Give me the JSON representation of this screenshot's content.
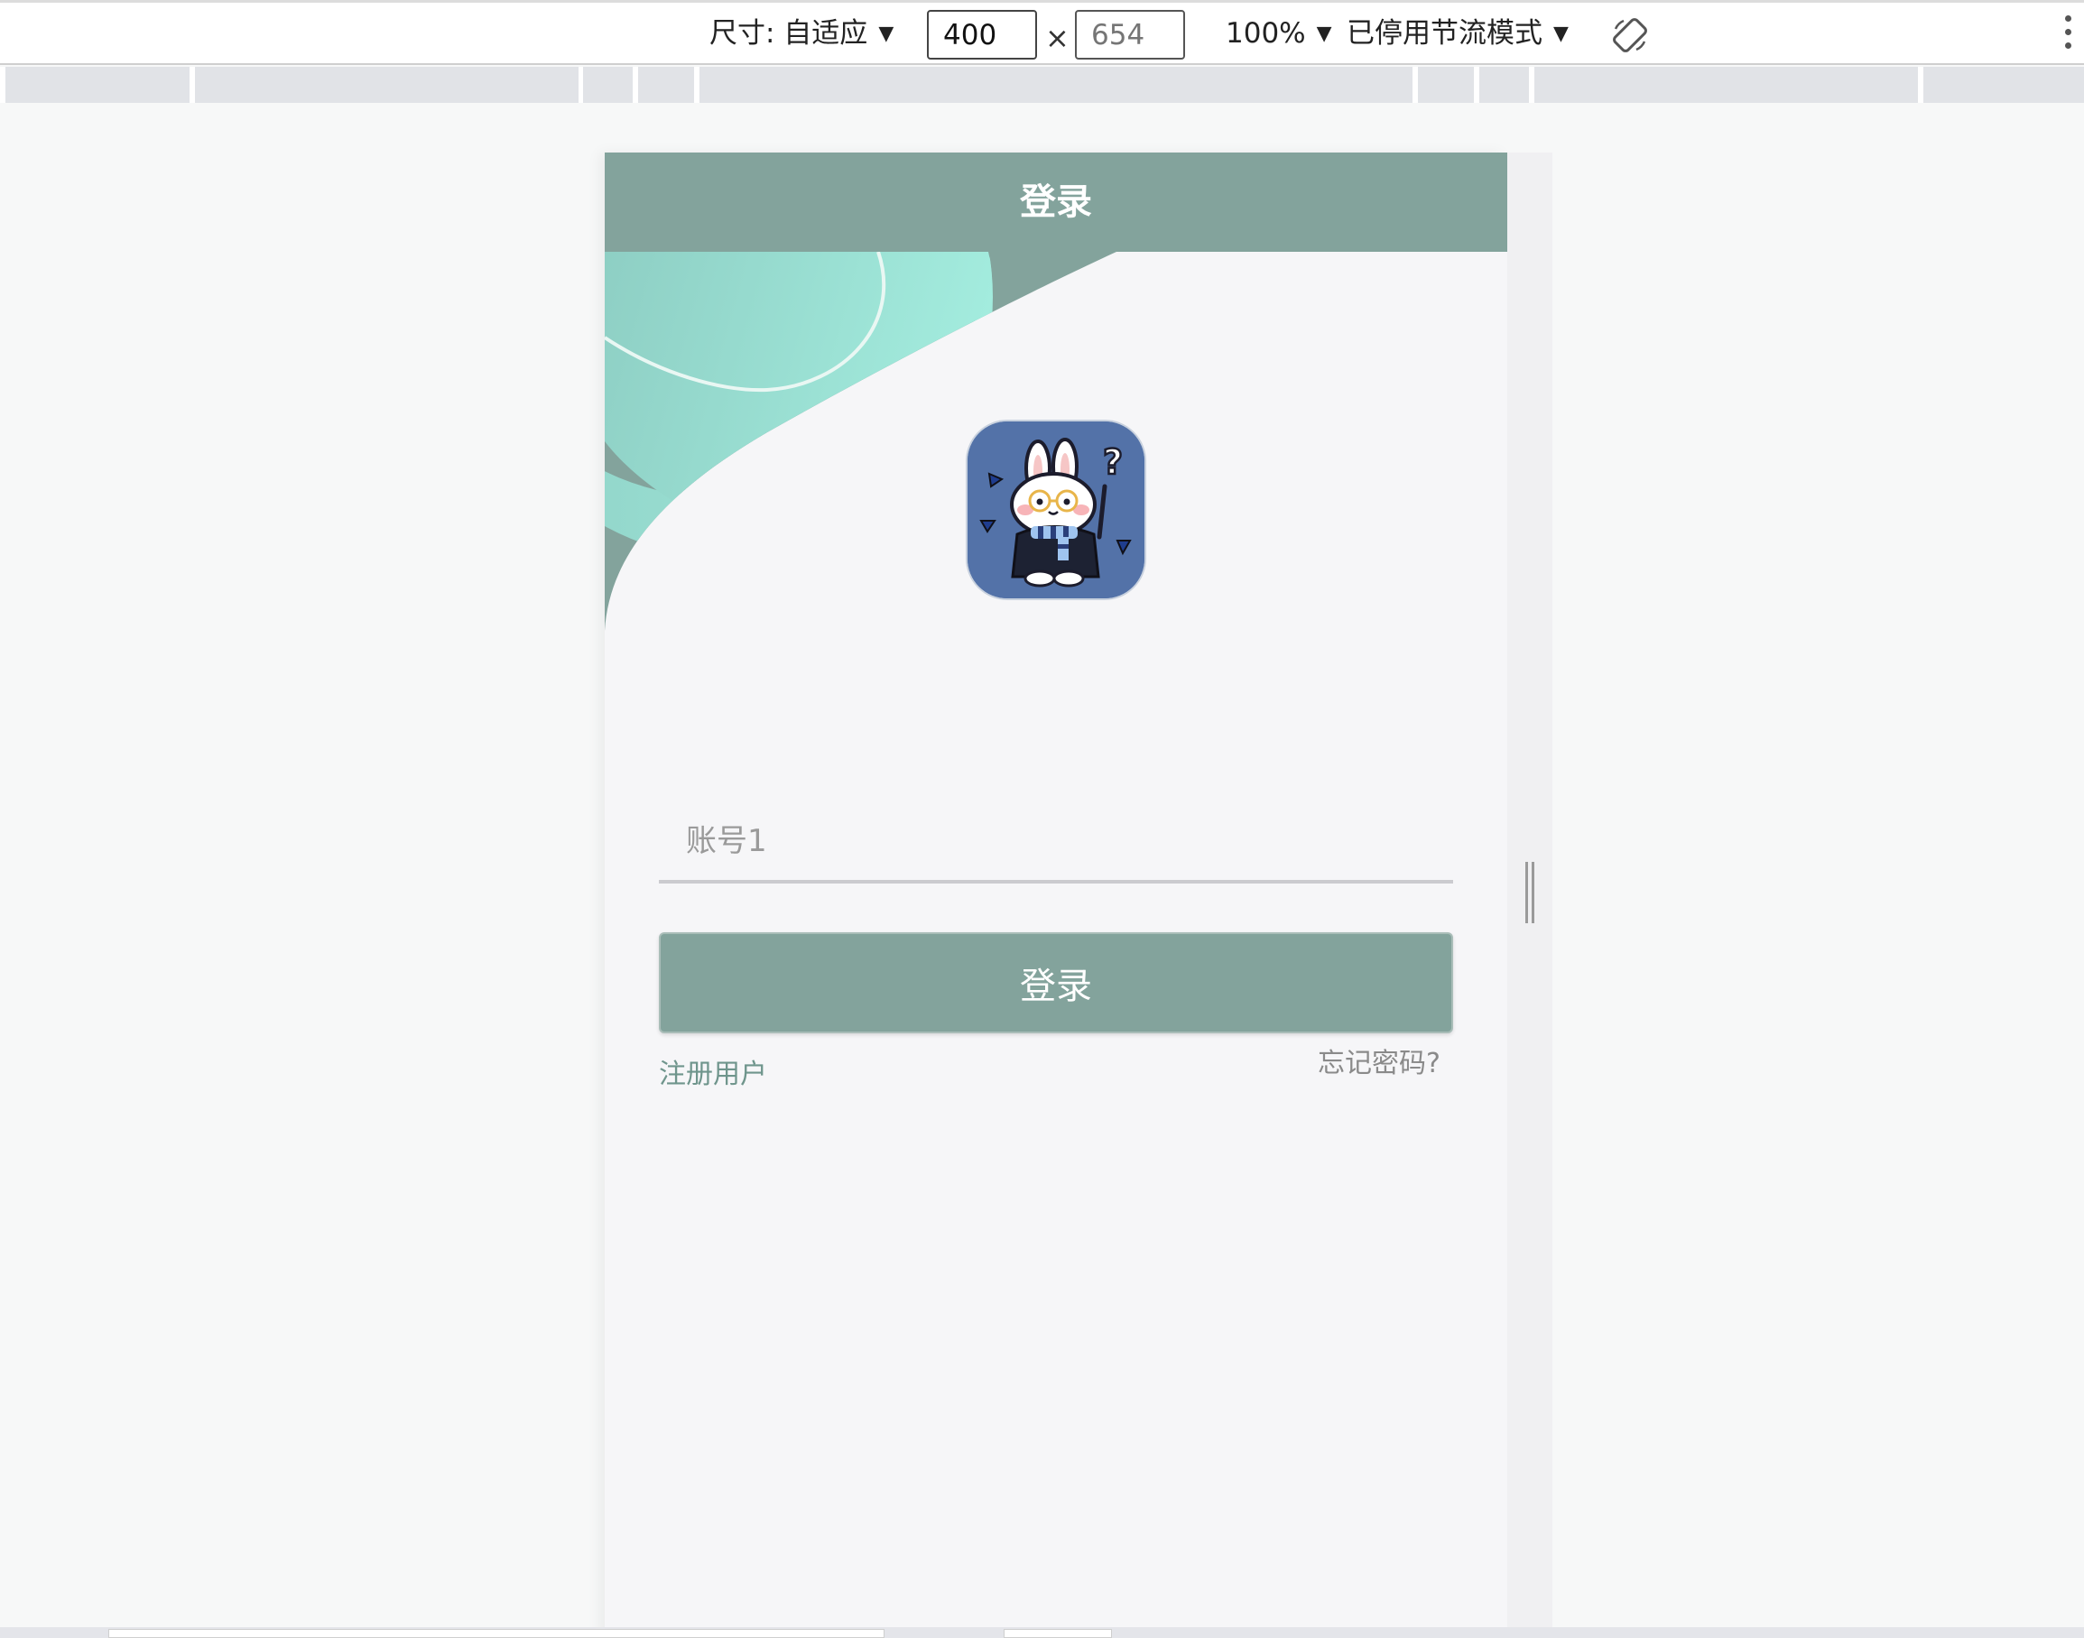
{
  "devtools": {
    "dimensions_label": "尺寸: 自适应",
    "width_value": "400",
    "height_placeholder": "654",
    "times_sign": "×",
    "zoom_label": "100%",
    "throttle_label": "已停用节流模式",
    "caret": "▼",
    "rotate_icon": "rotate-icon",
    "more_icon": "more-vertical-icon"
  },
  "app": {
    "header_title": "登录",
    "avatar_icon": "bunny-avatar-icon",
    "username_placeholder": "账号1",
    "password_mask": "••••••",
    "login_button": "登录",
    "register_link": "注册用户",
    "forgot_link": "忘记密码?"
  },
  "colors": {
    "primary": "#83a39c",
    "mint": "#9fe8da",
    "avatar_bg": "#5372a8",
    "page_bg": "#f6f6f8"
  }
}
